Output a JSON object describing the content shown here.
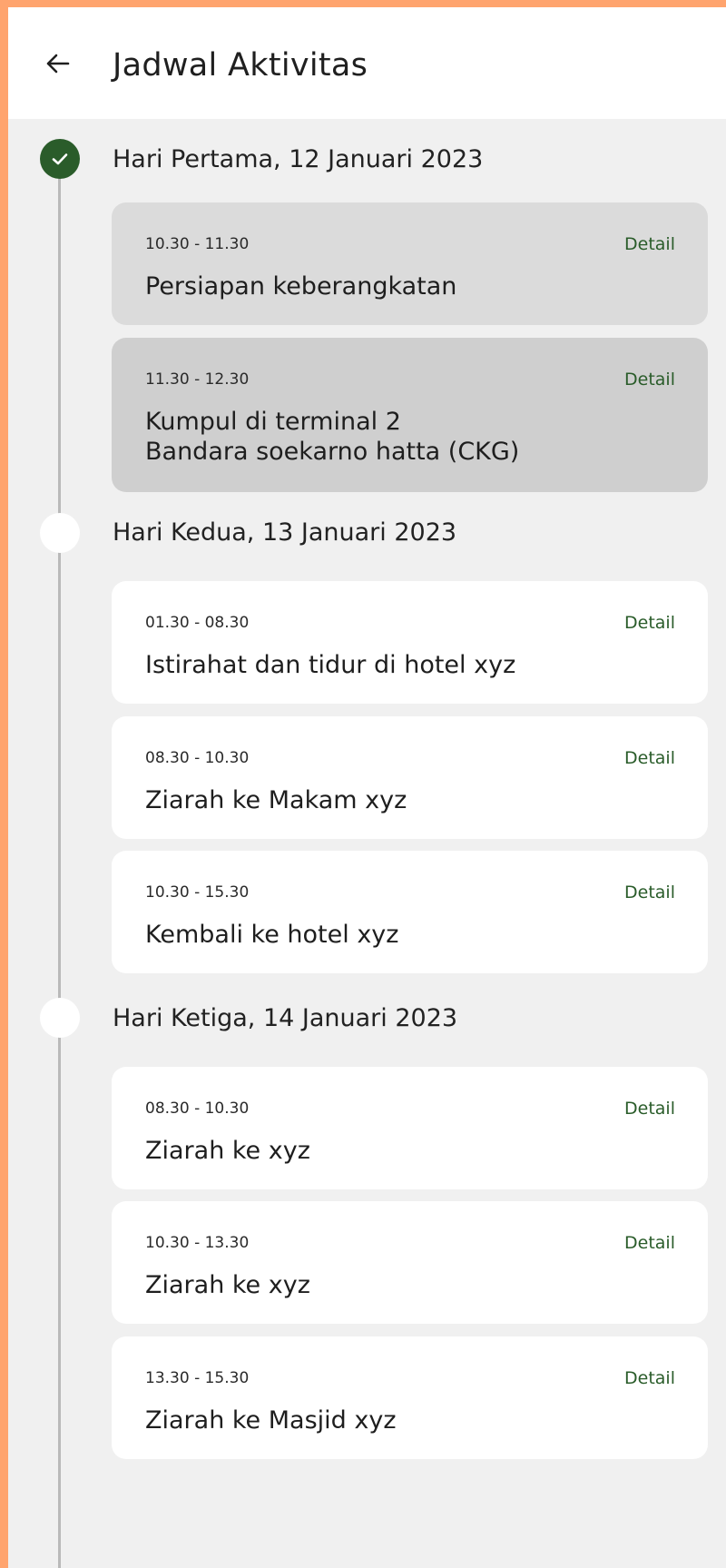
{
  "header": {
    "title": "Jadwal Aktivitas",
    "back_icon": "arrow-left-icon"
  },
  "colors": {
    "accent": "#2A5C2A",
    "outer_background": "#FFA46E",
    "screen_background": "#F0F0F0"
  },
  "days": [
    {
      "title": "Hari Pertama, 12 Januari 2023",
      "status": "completed",
      "activities": [
        {
          "time": "10.30 - 11.30",
          "name": "Persiapan keberangkatan",
          "detail": "Detail"
        },
        {
          "time": "11.30 - 12.30",
          "name": "Kumpul di terminal 2\nBandara soekarno hatta (CKG)",
          "detail": "Detail"
        }
      ]
    },
    {
      "title": "Hari Kedua, 13 Januari 2023",
      "status": "upcoming",
      "activities": [
        {
          "time": "01.30 - 08.30",
          "name": "Istirahat dan tidur di hotel xyz",
          "detail": "Detail"
        },
        {
          "time": "08.30 - 10.30",
          "name": "Ziarah ke Makam xyz",
          "detail": "Detail"
        },
        {
          "time": "10.30 - 15.30",
          "name": "Kembali ke hotel xyz",
          "detail": "Detail"
        }
      ]
    },
    {
      "title": "Hari Ketiga, 14 Januari 2023",
      "status": "upcoming",
      "activities": [
        {
          "time": "08.30 - 10.30",
          "name": "Ziarah ke xyz",
          "detail": "Detail"
        },
        {
          "time": "10.30 - 13.30",
          "name": "Ziarah ke xyz",
          "detail": "Detail"
        },
        {
          "time": "13.30 - 15.30",
          "name": "Ziarah ke Masjid xyz",
          "detail": "Detail"
        }
      ]
    }
  ]
}
